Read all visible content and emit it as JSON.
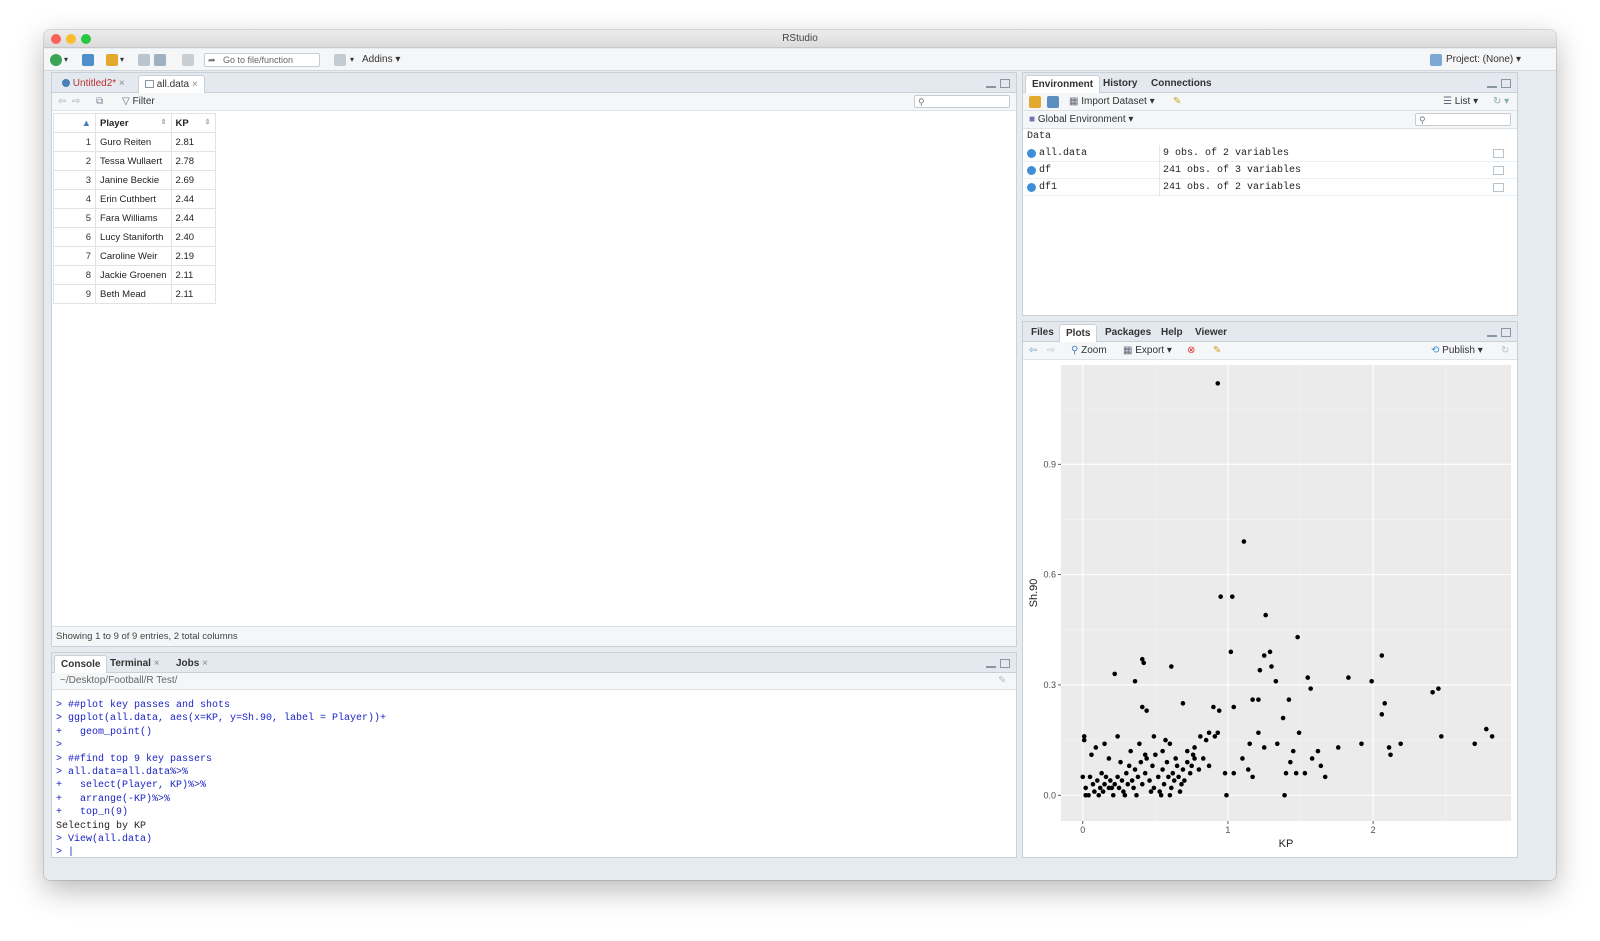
{
  "window": {
    "title": "RStudio"
  },
  "toolbar": {
    "goto_placeholder": "Go to file/function",
    "addins_label": "Addins",
    "project_label": "Project: (None)"
  },
  "source_pane": {
    "tabs": [
      {
        "label": "Untitled2*"
      },
      {
        "label": "all.data"
      }
    ],
    "filter_label": "Filter",
    "columns": [
      "Player",
      "KP"
    ],
    "rows": [
      {
        "n": "1",
        "player": "Guro Reiten",
        "kp": "2.81"
      },
      {
        "n": "2",
        "player": "Tessa Wullaert",
        "kp": "2.78"
      },
      {
        "n": "3",
        "player": "Janine Beckie",
        "kp": "2.69"
      },
      {
        "n": "4",
        "player": "Erin Cuthbert",
        "kp": "2.44"
      },
      {
        "n": "5",
        "player": "Fara Williams",
        "kp": "2.44"
      },
      {
        "n": "6",
        "player": "Lucy Staniforth",
        "kp": "2.40"
      },
      {
        "n": "7",
        "player": "Caroline Weir",
        "kp": "2.19"
      },
      {
        "n": "8",
        "player": "Jackie Groenen",
        "kp": "2.11"
      },
      {
        "n": "9",
        "player": "Beth Mead",
        "kp": "2.11"
      }
    ],
    "status": "Showing 1 to 9 of 9 entries, 2 total columns"
  },
  "console_pane": {
    "tabs": [
      {
        "label": "Console"
      },
      {
        "label": "Terminal"
      },
      {
        "label": "Jobs"
      }
    ],
    "path": "~/Desktop/Football/R Test/",
    "lines": [
      {
        "text": "> ##plot key passes and shots",
        "kind": "in"
      },
      {
        "text": "> ggplot(all.data, aes(x=KP, y=Sh.90, label = Player))+",
        "kind": "in"
      },
      {
        "text": "+   geom_point()",
        "kind": "in"
      },
      {
        "text": ">",
        "kind": "in"
      },
      {
        "text": "> ##find top 9 key passers",
        "kind": "in"
      },
      {
        "text": "> all.data=all.data%>%",
        "kind": "in"
      },
      {
        "text": "+   select(Player, KP)%>%",
        "kind": "in"
      },
      {
        "text": "+   arrange(-KP)%>%",
        "kind": "in"
      },
      {
        "text": "+   top_n(9)",
        "kind": "in"
      },
      {
        "text": "Selecting by KP",
        "kind": "out"
      },
      {
        "text": "> View(all.data)",
        "kind": "in"
      },
      {
        "text": "> |",
        "kind": "in"
      }
    ]
  },
  "env_pane": {
    "tabs": [
      {
        "label": "Environment"
      },
      {
        "label": "History"
      },
      {
        "label": "Connections"
      }
    ],
    "import_label": "Import Dataset",
    "list_label": "List",
    "scope_label": "Global Environment",
    "section_label": "Data",
    "items": [
      {
        "name": "all.data",
        "desc": "9 obs. of 2 variables"
      },
      {
        "name": "df",
        "desc": "241 obs. of 3 variables"
      },
      {
        "name": "df1",
        "desc": "241 obs. of 2 variables"
      }
    ]
  },
  "plots_pane": {
    "tabs": [
      {
        "label": "Files"
      },
      {
        "label": "Plots"
      },
      {
        "label": "Packages"
      },
      {
        "label": "Help"
      },
      {
        "label": "Viewer"
      }
    ],
    "zoom_label": "Zoom",
    "export_label": "Export",
    "publish_label": "Publish"
  },
  "chart_data": {
    "type": "scatter",
    "xlabel": "KP",
    "ylabel": "Sh.90",
    "xlim": [
      -0.15,
      2.95
    ],
    "ylim": [
      -0.07,
      1.17
    ],
    "x_ticks": [
      0,
      1,
      2
    ],
    "y_ticks": [
      0.0,
      0.3,
      0.6,
      0.9
    ],
    "grid": true,
    "points": [
      [
        0.93,
        1.12
      ],
      [
        1.11,
        0.69
      ],
      [
        0.95,
        0.54
      ],
      [
        1.03,
        0.54
      ],
      [
        1.26,
        0.49
      ],
      [
        1.48,
        0.43
      ],
      [
        1.02,
        0.39
      ],
      [
        1.29,
        0.39
      ],
      [
        1.25,
        0.38
      ],
      [
        2.06,
        0.38
      ],
      [
        1.3,
        0.35
      ],
      [
        1.22,
        0.34
      ],
      [
        1.55,
        0.32
      ],
      [
        1.83,
        0.32
      ],
      [
        0.41,
        0.37
      ],
      [
        0.42,
        0.36
      ],
      [
        0.61,
        0.35
      ],
      [
        0.36,
        0.31
      ],
      [
        0.22,
        0.33
      ],
      [
        1.33,
        0.31
      ],
      [
        1.57,
        0.29
      ],
      [
        1.99,
        0.31
      ],
      [
        2.41,
        0.28
      ],
      [
        2.45,
        0.29
      ],
      [
        1.17,
        0.26
      ],
      [
        1.21,
        0.26
      ],
      [
        1.04,
        0.24
      ],
      [
        0.41,
        0.24
      ],
      [
        0.44,
        0.23
      ],
      [
        0.9,
        0.24
      ],
      [
        0.94,
        0.23
      ],
      [
        0.69,
        0.25
      ],
      [
        1.38,
        0.21
      ],
      [
        2.06,
        0.22
      ],
      [
        2.08,
        0.25
      ],
      [
        1.42,
        0.26
      ],
      [
        0.87,
        0.17
      ],
      [
        0.91,
        0.16
      ],
      [
        0.93,
        0.17
      ],
      [
        0.85,
        0.15
      ],
      [
        0.81,
        0.16
      ],
      [
        0.77,
        0.13
      ],
      [
        0.72,
        0.12
      ],
      [
        0.57,
        0.15
      ],
      [
        0.6,
        0.14
      ],
      [
        0.49,
        0.16
      ],
      [
        0.39,
        0.14
      ],
      [
        0.24,
        0.16
      ],
      [
        0.15,
        0.14
      ],
      [
        0.01,
        0.16
      ],
      [
        0.01,
        0.15
      ],
      [
        1.15,
        0.14
      ],
      [
        1.21,
        0.17
      ],
      [
        1.25,
        0.13
      ],
      [
        1.34,
        0.14
      ],
      [
        1.49,
        0.17
      ],
      [
        1.45,
        0.12
      ],
      [
        1.62,
        0.12
      ],
      [
        1.76,
        0.13
      ],
      [
        1.92,
        0.14
      ],
      [
        2.11,
        0.13
      ],
      [
        2.19,
        0.14
      ],
      [
        2.47,
        0.16
      ],
      [
        2.7,
        0.14
      ],
      [
        2.78,
        0.18
      ],
      [
        2.82,
        0.16
      ],
      [
        1.1,
        0.1
      ],
      [
        1.14,
        0.07
      ],
      [
        1.43,
        0.09
      ],
      [
        1.58,
        0.1
      ],
      [
        1.64,
        0.08
      ],
      [
        2.12,
        0.11
      ],
      [
        0.0,
        0.05
      ],
      [
        0.02,
        0.02
      ],
      [
        0.04,
        0.0
      ],
      [
        0.05,
        0.05
      ],
      [
        0.08,
        0.01
      ],
      [
        0.1,
        0.04
      ],
      [
        0.12,
        0.02
      ],
      [
        0.13,
        0.06
      ],
      [
        0.15,
        0.03
      ],
      [
        0.16,
        0.05
      ],
      [
        0.18,
        0.02
      ],
      [
        0.19,
        0.04
      ],
      [
        0.21,
        0.0
      ],
      [
        0.22,
        0.03
      ],
      [
        0.24,
        0.05
      ],
      [
        0.25,
        0.02
      ],
      [
        0.27,
        0.04
      ],
      [
        0.28,
        0.01
      ],
      [
        0.3,
        0.06
      ],
      [
        0.31,
        0.03
      ],
      [
        0.32,
        0.08
      ],
      [
        0.34,
        0.04
      ],
      [
        0.35,
        0.02
      ],
      [
        0.36,
        0.07
      ],
      [
        0.38,
        0.05
      ],
      [
        0.4,
        0.09
      ],
      [
        0.41,
        0.03
      ],
      [
        0.43,
        0.06
      ],
      [
        0.44,
        0.1
      ],
      [
        0.46,
        0.04
      ],
      [
        0.48,
        0.08
      ],
      [
        0.49,
        0.02
      ],
      [
        0.5,
        0.11
      ],
      [
        0.52,
        0.05
      ],
      [
        0.53,
        0.01
      ],
      [
        0.55,
        0.07
      ],
      [
        0.56,
        0.03
      ],
      [
        0.58,
        0.09
      ],
      [
        0.59,
        0.05
      ],
      [
        0.61,
        0.02
      ],
      [
        0.62,
        0.06
      ],
      [
        0.63,
        0.04
      ],
      [
        0.65,
        0.08
      ],
      [
        0.66,
        0.05
      ],
      [
        0.68,
        0.03
      ],
      [
        0.69,
        0.07
      ],
      [
        0.7,
        0.04
      ],
      [
        0.72,
        0.09
      ],
      [
        0.74,
        0.06
      ],
      [
        0.75,
        0.08
      ],
      [
        0.77,
        0.1
      ],
      [
        0.8,
        0.07
      ],
      [
        0.83,
        0.1
      ],
      [
        0.87,
        0.08
      ],
      [
        0.98,
        0.06
      ],
      [
        1.04,
        0.06
      ],
      [
        1.17,
        0.05
      ],
      [
        1.4,
        0.06
      ],
      [
        1.47,
        0.06
      ],
      [
        1.53,
        0.06
      ],
      [
        1.67,
        0.05
      ],
      [
        1.39,
        0.0
      ],
      [
        0.06,
        0.11
      ],
      [
        0.09,
        0.13
      ],
      [
        0.18,
        0.1
      ],
      [
        0.26,
        0.09
      ],
      [
        0.33,
        0.12
      ],
      [
        0.43,
        0.11
      ],
      [
        0.55,
        0.12
      ],
      [
        0.64,
        0.1
      ],
      [
        0.76,
        0.11
      ],
      [
        0.99,
        0.0
      ],
      [
        0.02,
        0.0
      ],
      [
        0.07,
        0.03
      ],
      [
        0.11,
        0.0
      ],
      [
        0.14,
        0.01
      ],
      [
        0.2,
        0.02
      ],
      [
        0.29,
        0.0
      ],
      [
        0.37,
        0.0
      ],
      [
        0.47,
        0.01
      ],
      [
        0.54,
        0.0
      ],
      [
        0.6,
        0.0
      ],
      [
        0.67,
        0.01
      ]
    ]
  }
}
